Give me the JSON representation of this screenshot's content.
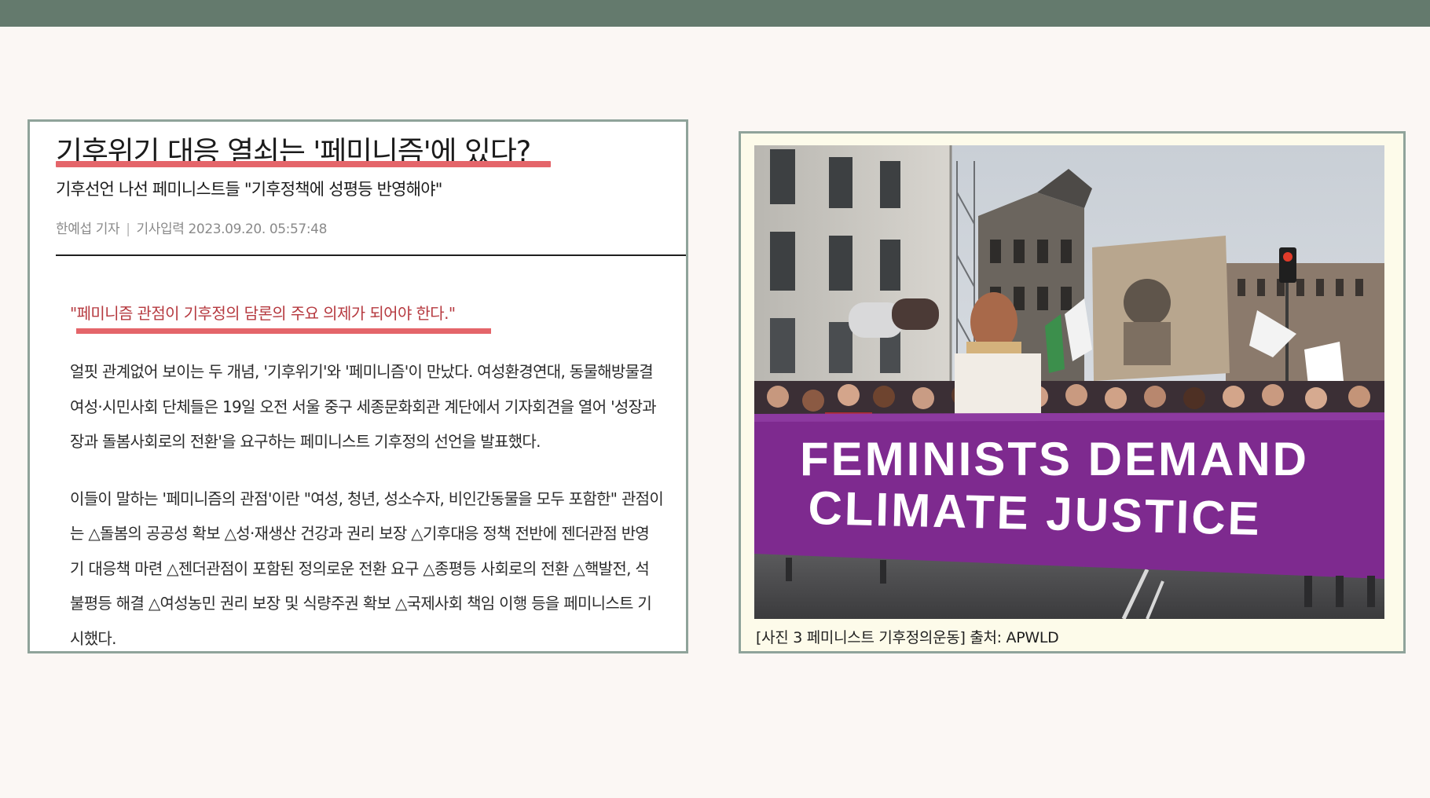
{
  "article": {
    "headline": "기후위기 대응 열쇠는 '페미니즘'에 있다?",
    "subheadline": "기후선언 나선 페미니스트들 \"기후정책에 성평등 반영해야\"",
    "byline": {
      "author": "한예섭 기자",
      "separator": "|",
      "published": "기사입력 2023.09.20. 05:57:48"
    },
    "pull_quote": "\"페미니즘 관점이 기후정의 담론의 주요 의제가 되어야 한다.\"",
    "paragraph1": [
      "얼핏 관계없어 보이는 두 개념, '기후위기'와 '페미니즘'이 만났다. 여성환경연대, 동물해방물결",
      "여성·시민사회 단체들은 19일 오전 서울 중구 세종문화회관 계단에서 기자회견을 열어 '성장과",
      "장과 돌봄사회로의 전환'을 요구하는 페미니스트 기후정의 선언을 발표했다."
    ],
    "paragraph2": [
      "이들이 말하는 '페미니즘의 관점'이란 \"여성, 청년, 성소수자, 비인간동물을 모두 포함한\" 관점이",
      "는 △돌봄의 공공성 확보 △성·재생산 건강과 권리 보장 △기후대응 정책 전반에 젠더관점 반영",
      "기 대응책 마련 △젠더관점이 포함된 정의로운 전환 요구 △종평등 사회로의 전환 △핵발전, 석",
      "불평등 해결 △여성농민 권리 보장 및 식량주권 확보 △국제사회 책임 이행 등을 페미니스트 기",
      "시했다."
    ]
  },
  "photo": {
    "banner_line1": "FEMINISTS DEMAND",
    "banner_line2": "CLIMATE JUSTICE",
    "caption": "[사진 3 페미니스트 기후정의운동] 출처: APWLD"
  },
  "colors": {
    "top_bar": "#647a6d",
    "frame_border": "#8fa39a",
    "highlight_underline": "#e4656a",
    "quote_text": "#b63a40",
    "banner_purple": "#7e2a8f"
  }
}
